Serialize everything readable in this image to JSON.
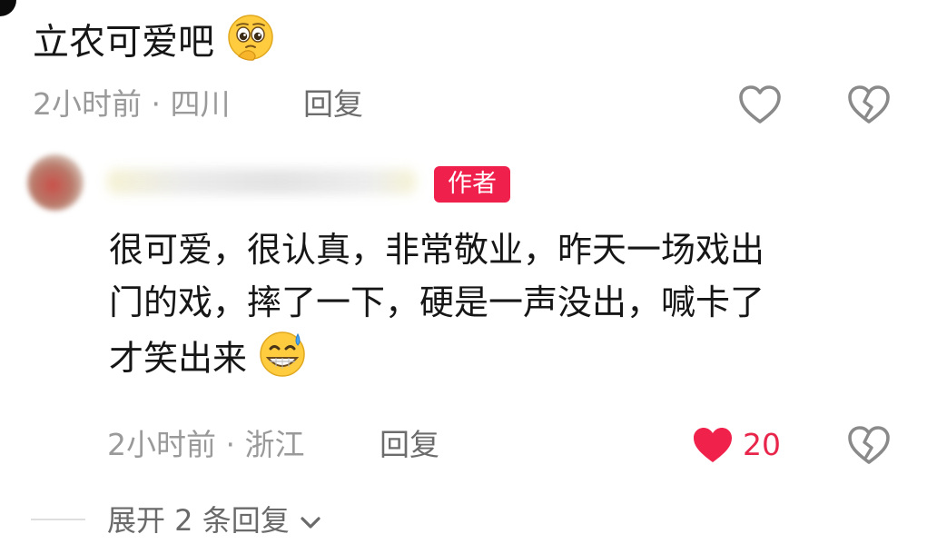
{
  "comment_main": {
    "text": "立农可爱吧",
    "emoji": "pleading-face-emoji",
    "time": "2小时前",
    "separator": "·",
    "location": "四川",
    "reply_label": "回复"
  },
  "comment_reply": {
    "author_badge": "作者",
    "lines": [
      "很可爱，很认真，非常敬业，昨天一场戏出",
      "门的戏，摔了一下，硬是一声没出，喊卡了",
      "才笑出来"
    ],
    "emoji": "grinning-sweat-emoji",
    "time": "2小时前",
    "separator": "·",
    "location": "浙江",
    "reply_label": "回复",
    "like_count": "20",
    "liked": true
  },
  "expand_replies": {
    "label": "展开 2 条回复"
  },
  "colors": {
    "liked": "#f0224c",
    "badge": "#f0204d",
    "icon_outline": "#888888",
    "meta_text": "#9a9a9a"
  }
}
